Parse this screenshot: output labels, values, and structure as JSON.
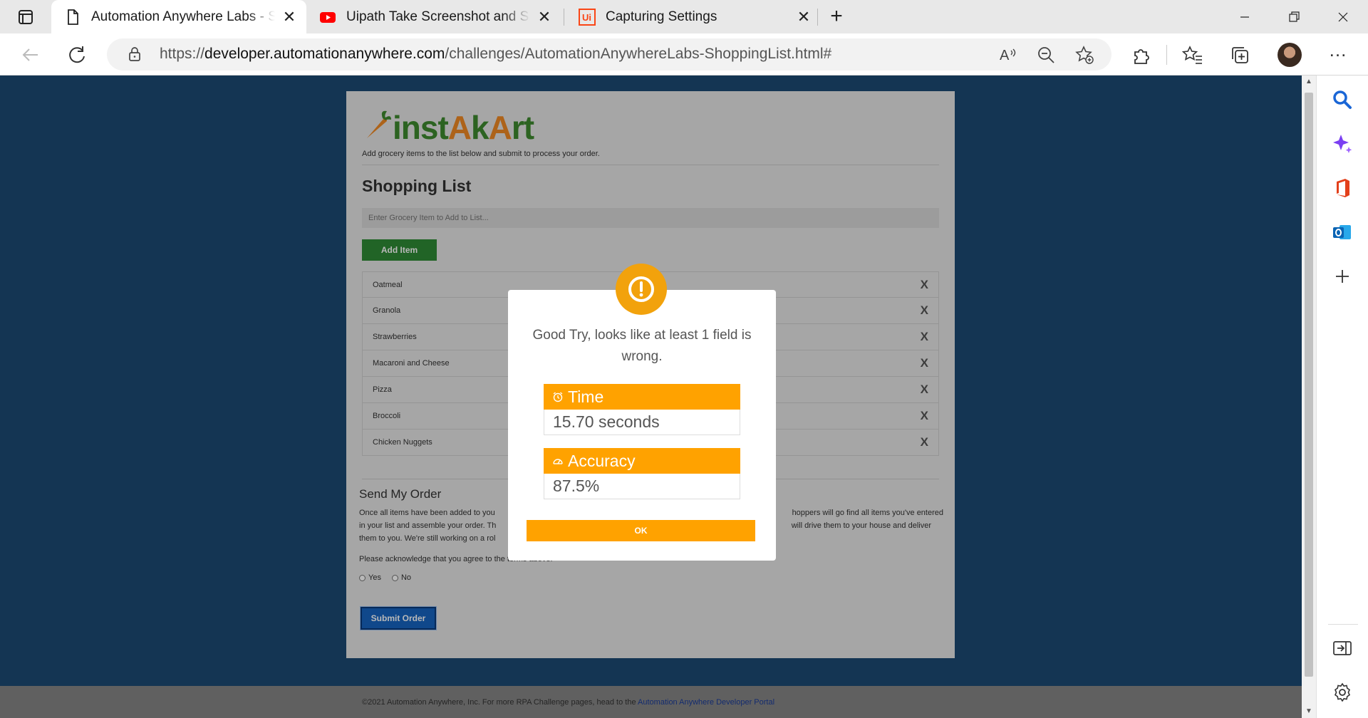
{
  "browser": {
    "tabs": [
      {
        "title": "Automation Anywhere Labs - Shopping List",
        "icon": "page-icon",
        "active": true
      },
      {
        "title": "Uipath Take Screenshot and Save",
        "icon": "youtube-icon",
        "active": false
      },
      {
        "title": "Capturing Settings",
        "icon": "uipath-icon",
        "active": false
      }
    ],
    "url_prefix": "https://",
    "url_host": "developer.automationanywhere.com",
    "url_path": "/challenges/AutomationAnywhereLabs-ShoppingList.html#",
    "read_aloud_label": "A"
  },
  "page": {
    "logo": {
      "part1": "inst",
      "part2": "A",
      "part3": "k",
      "part4": "A",
      "part5": "rt"
    },
    "intro": "Add grocery items to the list below and submit to process your order.",
    "heading": "Shopping List",
    "input_placeholder": "Enter Grocery Item to Add to List...",
    "add_button": "Add Item",
    "items": [
      {
        "name": "Oatmeal",
        "remove": "X"
      },
      {
        "name": "Granola",
        "remove": "X"
      },
      {
        "name": "Strawberries",
        "remove": "X"
      },
      {
        "name": "Macaroni and Cheese",
        "remove": "X"
      },
      {
        "name": "Pizza",
        "remove": "X"
      },
      {
        "name": "Broccoli",
        "remove": "X"
      },
      {
        "name": "Chicken Nuggets",
        "remove": "X"
      }
    ],
    "send_heading": "Send My Order",
    "send_desc_left": "Once all items have been added to you",
    "send_desc_right": "hoppers will go find all items you've entered",
    "send_desc_line2_left": "in your list and assemble your order. Th",
    "send_desc_line2_right": "will drive them to your house and deliver",
    "send_desc_line3": "them to you. We're still working on a rol",
    "ack": "Please acknowledge that you agree to the terms above.",
    "radio_yes": "Yes",
    "radio_no": "No",
    "submit": "Submit Order",
    "footer_text": "©2021 Automation Anywhere, Inc. For more RPA Challenge pages, head to the ",
    "footer_link": "Automation Anywhere Developer Portal"
  },
  "modal": {
    "message": "Good Try, looks like at least 1 field is wrong.",
    "time_label": "Time",
    "time_value": "15.70 seconds",
    "accuracy_label": "Accuracy",
    "accuracy_value": "87.5%",
    "ok": "OK",
    "accent": "#FFA200"
  }
}
